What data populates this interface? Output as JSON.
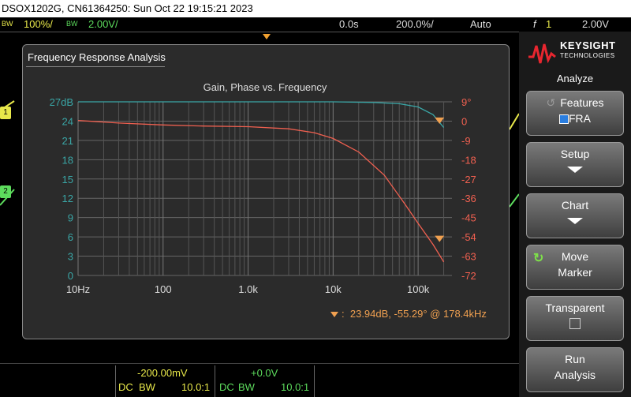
{
  "titlebar": "DSOX1202G, CN61364250: Sun Oct 22 19:15:21 2023",
  "status": {
    "ch1_bw": "BW",
    "ch1_scale": "100%/",
    "ch2_bw": "BW",
    "ch2_scale": "2.00V/",
    "time_pos": "0.0s",
    "time_scale": "200.0%/",
    "trigger_mode": "Auto",
    "trigger_icon": "f",
    "trigger_src": "1",
    "trigger_level": "2.00V"
  },
  "fra": {
    "panel_title": "Frequency Response Analysis",
    "marker_readout": "23.94dB, -55.29° @ 178.4kHz",
    "marker_prefix": ":"
  },
  "chart_data": {
    "type": "line",
    "title": "Gain, Phase vs. Frequency",
    "x_scale": "log",
    "x_ticks": [
      "10Hz",
      "100",
      "1.0k",
      "10k",
      "100k"
    ],
    "x_tick_values": [
      10,
      100,
      1000,
      10000,
      100000
    ],
    "xlim": [
      10,
      250000
    ],
    "y_left_ticks": [
      "27dB",
      "24",
      "21",
      "18",
      "15",
      "12",
      "9",
      "6",
      "3",
      "0"
    ],
    "y_left_lim": [
      0,
      27
    ],
    "y_right_ticks": [
      "9°",
      "0",
      "-9",
      "-18",
      "-27",
      "-36",
      "-45",
      "-54",
      "-63",
      "-72"
    ],
    "y_right_lim": [
      -72,
      9
    ],
    "colors": {
      "gain": "#3aa6a6",
      "phase": "#f06050",
      "marker": "#f0a050"
    },
    "series": [
      {
        "axis": "left",
        "x": [
          10,
          100,
          1000,
          10000,
          30000,
          60000,
          100000,
          150000,
          200000
        ],
        "values": [
          27.0,
          27.0,
          27.0,
          27.0,
          26.9,
          26.7,
          26.2,
          25.0,
          23.0
        ]
      },
      {
        "axis": "right",
        "x": [
          10,
          30,
          100,
          300,
          1000,
          3000,
          6000,
          10000,
          20000,
          40000,
          70000,
          100000,
          150000,
          200000
        ],
        "values": [
          0.3,
          -0.9,
          -1.8,
          -2.3,
          -2.6,
          -3.6,
          -5.4,
          -8.1,
          -14.4,
          -25.2,
          -38.7,
          -47.7,
          -57.6,
          -65.7
        ]
      }
    ],
    "markers": [
      {
        "axis": "left",
        "x": 178400,
        "y": 23.94
      },
      {
        "axis": "right",
        "x": 178400,
        "y": -55.29
      }
    ]
  },
  "sidepanel": {
    "brand": "KEYSIGHT",
    "brand_sub": "TECHNOLOGIES",
    "menu_title": "Analyze",
    "softkeys": {
      "features_l1": "Features",
      "features_l2": "FRA",
      "setup": "Setup",
      "chart": "Chart",
      "move_l1": "Move",
      "move_l2": "Marker",
      "transparent": "Transparent",
      "run_l1": "Run",
      "run_l2": "Analysis"
    }
  },
  "bottombar": {
    "ch1_offset": "-200.00mV",
    "ch1_coupling": "DC",
    "ch1_bw": "BW",
    "ch1_probe": "10.0:1",
    "ch2_offset": "+0.0V",
    "ch2_coupling": "DC",
    "ch2_bw": "BW",
    "ch2_probe": "10.0:1"
  },
  "channel_markers": {
    "ch1": "1",
    "ch2": "2"
  }
}
